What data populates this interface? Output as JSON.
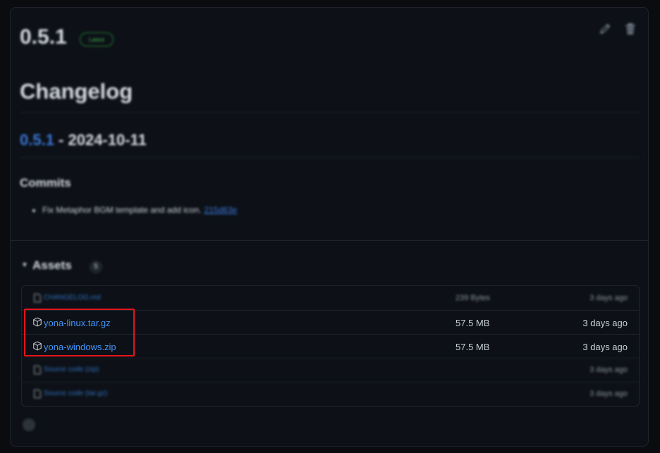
{
  "release": {
    "title": "0.5.1",
    "badge": "Latest"
  },
  "body": {
    "heading": "Changelog",
    "version_link": "0.5.1",
    "version_date": " - 2024-10-11",
    "commits_heading": "Commits",
    "commit_text": "Fix Metaphor BGM template and add icon.",
    "commit_hash": "215d63e"
  },
  "assets": {
    "label": "Assets",
    "count": "5",
    "items": [
      {
        "name": "CHANGELOG.md",
        "size": "239 Bytes",
        "time": "3 days ago"
      },
      {
        "name": "yona-linux.tar.gz",
        "size": "57.5 MB",
        "time": "3 days ago"
      },
      {
        "name": "yona-windows.zip",
        "size": "57.5 MB",
        "time": "3 days ago"
      },
      {
        "name": "Source code (zip)",
        "size": "",
        "time": "3 days ago"
      },
      {
        "name": "Source code (tar.gz)",
        "size": "",
        "time": "3 days ago"
      }
    ]
  },
  "icons": {
    "edit": "pencil-icon",
    "delete": "trash-icon",
    "package": "package-icon",
    "file": "file-zip-icon",
    "reaction": "smiley-icon"
  },
  "colors": {
    "link": "#4493f8",
    "highlight": "#e5141a",
    "latest": "#3fb950"
  }
}
